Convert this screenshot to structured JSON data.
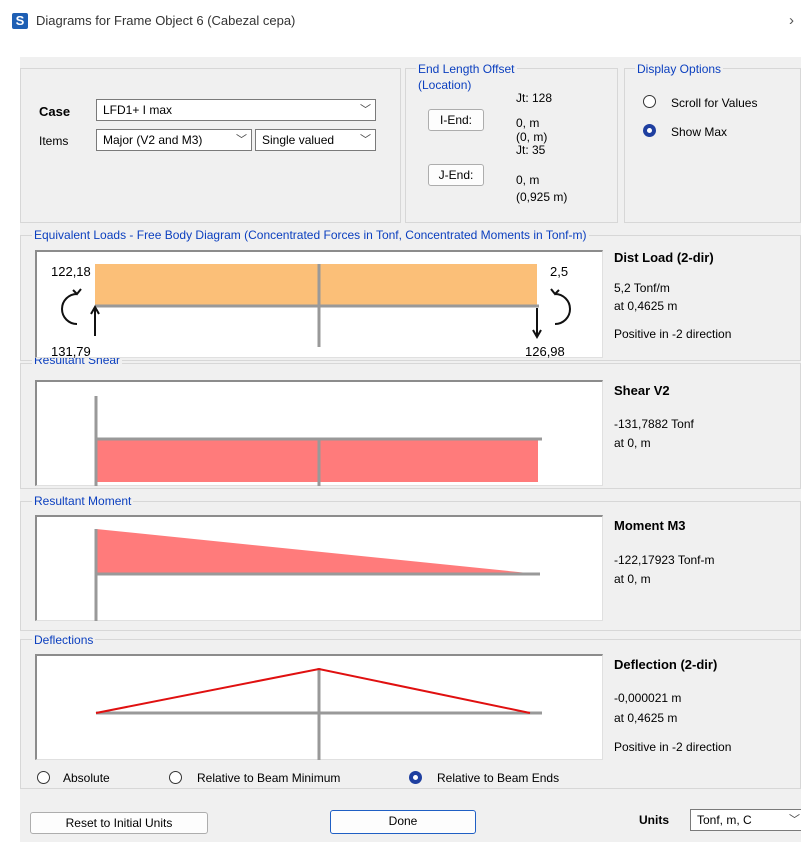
{
  "window": {
    "title": "Diagrams for Frame Object 6  (Cabezal cepa)",
    "app_icon": "S"
  },
  "case": {
    "label": "Case",
    "value": "LFD1+ I max"
  },
  "items": {
    "label": "Items",
    "component": "Major (V2 and M3)",
    "mode": "Single valued"
  },
  "end_length_offset": {
    "title": "End Length Offset",
    "location": "(Location)",
    "i_end": {
      "button": "I-End:",
      "jt": "Jt:  128",
      "offset": "0, m",
      "location": "(0, m)"
    },
    "j_end": {
      "button": "J-End:",
      "jt": "Jt:  35",
      "offset": "0, m",
      "location": "(0,925 m)"
    }
  },
  "display_options": {
    "title": "Display Options",
    "scroll": "Scroll for Values",
    "show_max": "Show Max",
    "selected": "show_max"
  },
  "equivalent_loads": {
    "title": "Equivalent Loads - Free Body Diagram  (Concentrated Forces in Tonf, Concentrated Moments in Tonf-m)",
    "moment_left": "122,18",
    "moment_right": "2,5",
    "force_left": "131,79",
    "force_right": "126,98",
    "info_title": "Dist Load (2-dir)",
    "info_value": "5,2 Tonf/m",
    "info_at": "at 0,4625 m",
    "info_dir": "Positive in -2 direction",
    "fill_color": "#fbbf78"
  },
  "shear": {
    "title": "Resultant Shear",
    "info_title": "Shear V2",
    "info_value": "-131,7882 Tonf",
    "info_at": "at 0, m",
    "fill_color": "#ff7b7b"
  },
  "moment": {
    "title": "Resultant Moment",
    "info_title": "Moment M3",
    "info_value": "-122,17923 Tonf-m",
    "info_at": "at 0, m",
    "fill_color": "#ff7b7b"
  },
  "deflections": {
    "title": "Deflections",
    "info_title": "Deflection (2-dir)",
    "info_value": "-0,000021 m",
    "info_at": "at 0,4625 m",
    "info_dir": "Positive in -2 direction",
    "line_color": "#e01010",
    "options": [
      "Absolute",
      "Relative to Beam Minimum",
      "Relative to Beam Ends"
    ],
    "selected": "Relative to Beam Ends"
  },
  "footer": {
    "reset": "Reset to Initial Units",
    "done": "Done",
    "units_label": "Units",
    "units_value": "Tonf, m, C"
  }
}
